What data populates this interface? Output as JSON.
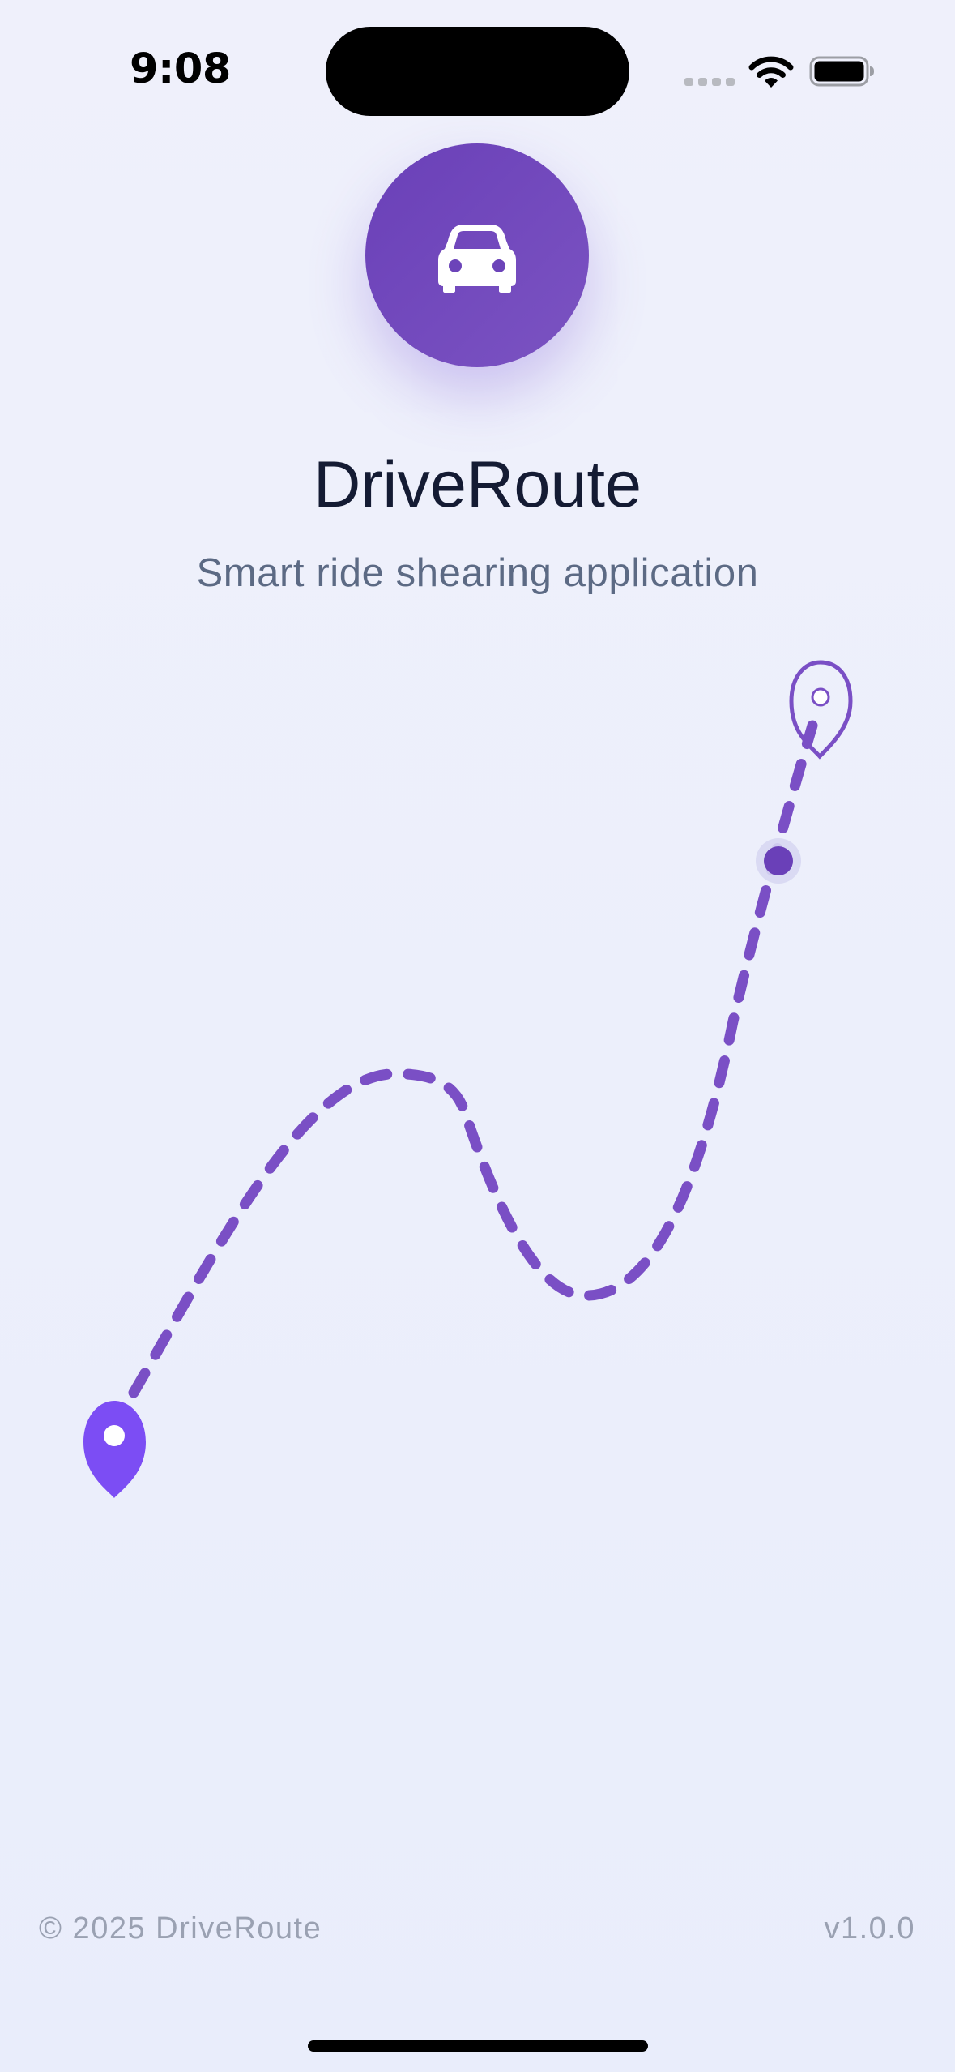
{
  "status_bar": {
    "time": "9:08",
    "icons": [
      "cellular-signal-icon",
      "wifi-icon",
      "battery-icon"
    ]
  },
  "logo": {
    "icon": "car-icon"
  },
  "app": {
    "title": "DriveRoute",
    "subtitle": "Smart ride shearing application"
  },
  "illustration": {
    "icons": [
      "start-pin-icon",
      "destination-pin-icon",
      "vehicle-position-dot"
    ]
  },
  "footer": {
    "copyright": "© 2025 DriveRoute",
    "version": "v1.0.0"
  },
  "colors": {
    "brand_purple": "#6c44b9",
    "route_purple": "#7a4fc5",
    "pin_purple": "#7c4df4",
    "title": "#141b33",
    "subtitle": "#5c6a84",
    "footer_text": "#9aa1b2",
    "background": "#eceffb"
  }
}
